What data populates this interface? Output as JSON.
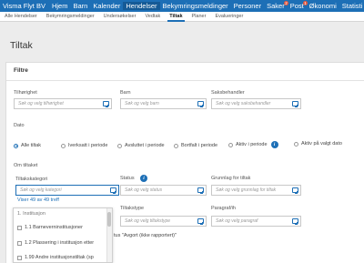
{
  "topnav": {
    "brand": "Visma Flyt BV",
    "items": [
      "Hjem",
      "Barn",
      "Kalender",
      "Hendelser",
      "Bekymringsmeldinger",
      "Personer",
      "Saker",
      "Post",
      "Økonomi",
      "Statisti"
    ],
    "badges": {
      "saker": "2",
      "post": "1"
    }
  },
  "subnav": {
    "items": [
      "Alle Hendelser",
      "Bekymringsmeldinger",
      "Undersøkelser",
      "Vedtak",
      "Tiltak",
      "Planer",
      "Evalueringer"
    ]
  },
  "page": {
    "title": "Tiltak"
  },
  "filter": {
    "title": "Filtre",
    "tilhorighet": {
      "label": "Tilhørighet",
      "placeholder": "Søk og velg tilhørighet"
    },
    "barn": {
      "label": "Barn",
      "placeholder": "Søk og velg barn"
    },
    "saksbehandler": {
      "label": "Saksbehandler",
      "placeholder": "Søk og velg saksbehandler"
    },
    "dato": {
      "label": "Dato",
      "options": [
        "Alle tiltak",
        "Iverksatt i periode",
        "Avsluttet i periode",
        "Bortfalt i periode",
        "Aktiv i periode",
        "Aktiv på valgt dato"
      ]
    },
    "om_tiltaket": {
      "label": "Om tiltaket"
    },
    "tiltakskategori": {
      "label": "Tiltakskategori",
      "placeholder": "Søk og velg kategori",
      "count_text": "Viser 49 av 49 treff"
    },
    "status": {
      "label": "Status",
      "placeholder": "Søk og velg status"
    },
    "grunnlag": {
      "label": "Grunnlag for tiltak",
      "placeholder": "Søk og velg grunnlag for tiltak"
    },
    "tiltakstype": {
      "label": "Tiltakstype",
      "placeholder": "Søk og velg tiltakstype"
    },
    "paragraf": {
      "label": "Paragraf/ih",
      "placeholder": "Søk og velg paragraf"
    },
    "status_note": "tus \"Avgort (ikke rapportert)\""
  },
  "dropdown": {
    "group": "1. Institusjon",
    "items": [
      "1.1 Barneverninstitusjoner",
      "1.2 Plassering i institusjon etter",
      "1.99 Andre institusjonstiltak (sp"
    ]
  }
}
